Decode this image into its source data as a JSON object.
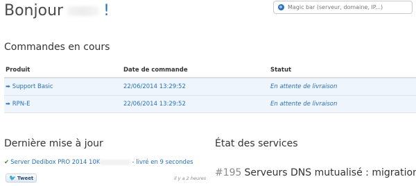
{
  "header": {
    "greeting": "Bonjour",
    "exclamation": "!",
    "magic_bar_placeholder": "Magic bar (serveur, domaine, IP...)"
  },
  "orders": {
    "title": "Commandes en cours",
    "columns": [
      "Produit",
      "Date de commande",
      "Statut"
    ],
    "rows": [
      {
        "product": "Support Basic",
        "date": "22/06/2014 13:29:52",
        "status": "En attente de livraison"
      },
      {
        "product": "RPN-E",
        "date": "22/06/2014 13:29:52",
        "status": "En attente de livraison"
      }
    ]
  },
  "updates": {
    "title": "Dernière mise à jour",
    "item_prefix": "Server Dedibox PRO 2014 10K",
    "item_suffix": "- livré en 9 secondes",
    "tweet_label": "Tweet",
    "ago": "il y a 2 heures"
  },
  "services": {
    "title": "État des services",
    "number": "#195",
    "text": "Serveurs DNS mutualisé : migration"
  }
}
